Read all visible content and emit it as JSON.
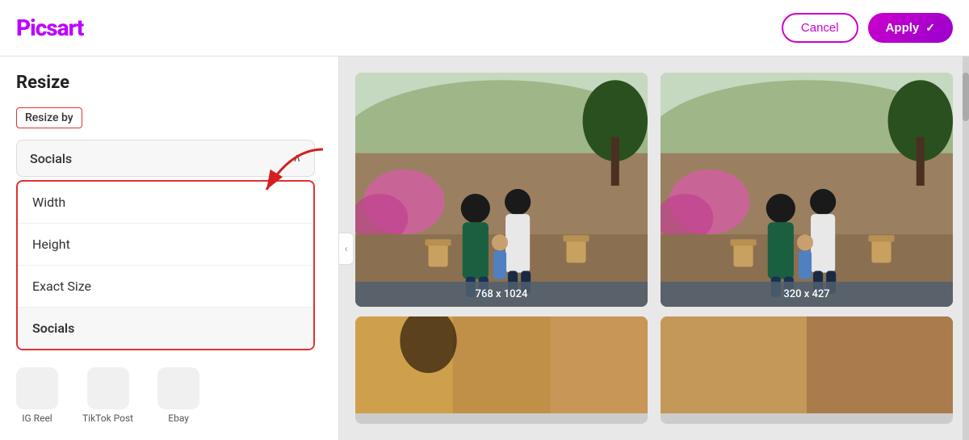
{
  "header": {
    "logo": "Picsart",
    "cancel_label": "Cancel",
    "apply_label": "Apply",
    "apply_checkmark": "✓"
  },
  "sidebar": {
    "title": "Resize",
    "resize_by_label": "Resize by",
    "dropdown_selected": "Socials",
    "chevron": "∧",
    "menu_items": [
      {
        "label": "Width"
      },
      {
        "label": "Height"
      },
      {
        "label": "Exact Size"
      },
      {
        "label": "Socials"
      }
    ],
    "bottom_icons": [
      {
        "label": "IG Reel"
      },
      {
        "label": "TikTok Post"
      },
      {
        "label": "Ebay"
      }
    ]
  },
  "content": {
    "image1_label": "768 x 1024",
    "image2_label": "320 x 427",
    "collapse_arrow": "‹"
  },
  "colors": {
    "brand": "#bf00ff",
    "red_border": "#e53030",
    "apply_gradient_start": "#cc00cc",
    "apply_gradient_end": "#9900cc"
  }
}
